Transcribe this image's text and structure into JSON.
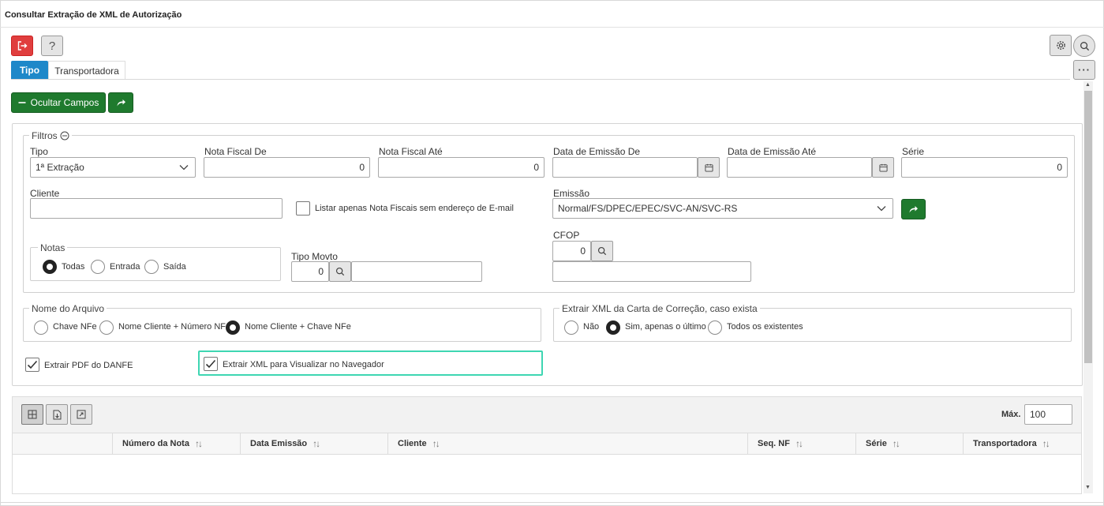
{
  "window": {
    "title": "Consultar Extração de XML de Autorização"
  },
  "toolbar": {
    "help_label": "?",
    "more_label": "···"
  },
  "tabs": [
    {
      "label": "Tipo",
      "active": true
    },
    {
      "label": "Transportadora",
      "active": false
    }
  ],
  "actions": {
    "hide_fields_label": "Ocultar Campos"
  },
  "filters": {
    "legend": "Filtros",
    "tipo": {
      "label": "Tipo",
      "value": "1ª Extração"
    },
    "nota_fiscal_de": {
      "label": "Nota Fiscal De",
      "value": "0"
    },
    "nota_fiscal_ate": {
      "label": "Nota Fiscal Até",
      "value": "0"
    },
    "data_emissao_de": {
      "label": "Data de Emissão De",
      "value": ""
    },
    "data_emissao_ate": {
      "label": "Data de Emissão Até",
      "value": ""
    },
    "serie": {
      "label": "Série",
      "value": "0"
    },
    "cliente": {
      "label": "Cliente",
      "value": ""
    },
    "listar_sem_email": {
      "label": "Listar apenas Nota Fiscais sem endereço de E-mail",
      "checked": false
    },
    "emissao": {
      "label": "Emissão",
      "value": "Normal/FS/DPEC/EPEC/SVC-AN/SVC-RS"
    },
    "notas": {
      "legend": "Notas",
      "options": [
        "Todas",
        "Entrada",
        "Saída"
      ],
      "selected": "Todas"
    },
    "tipo_movto": {
      "label": "Tipo Movto",
      "code": "0",
      "description": ""
    },
    "cfop": {
      "label": "CFOP",
      "code": "0",
      "description": ""
    }
  },
  "nome_arquivo": {
    "legend": "Nome do Arquivo",
    "options": [
      "Chave NFe",
      "Nome Cliente + Número NF",
      "Nome Cliente + Chave NFe"
    ],
    "selected": "Nome Cliente + Chave NFe"
  },
  "carta_correcao": {
    "legend": "Extrair XML da Carta de Correção, caso exista",
    "options": [
      "Não",
      "Sim, apenas o último",
      "Todos os existentes"
    ],
    "selected": "Sim, apenas o último"
  },
  "extrair_pdf": {
    "label": "Extrair PDF do DANFE",
    "checked": true
  },
  "extrair_xml": {
    "label": "Extrair XML para Visualizar no Navegador",
    "checked": true
  },
  "grid": {
    "max_label": "Máx.",
    "max_value": "100",
    "columns": [
      "Número da Nota",
      "Data Emissão",
      "Cliente",
      "Seq. NF",
      "Série",
      "Transportadora"
    ],
    "rows": []
  },
  "colors": {
    "accent": "#1e88c9",
    "green": "#1f7a2e",
    "danger": "#e03e3e",
    "highlight": "#3ed6b2"
  }
}
